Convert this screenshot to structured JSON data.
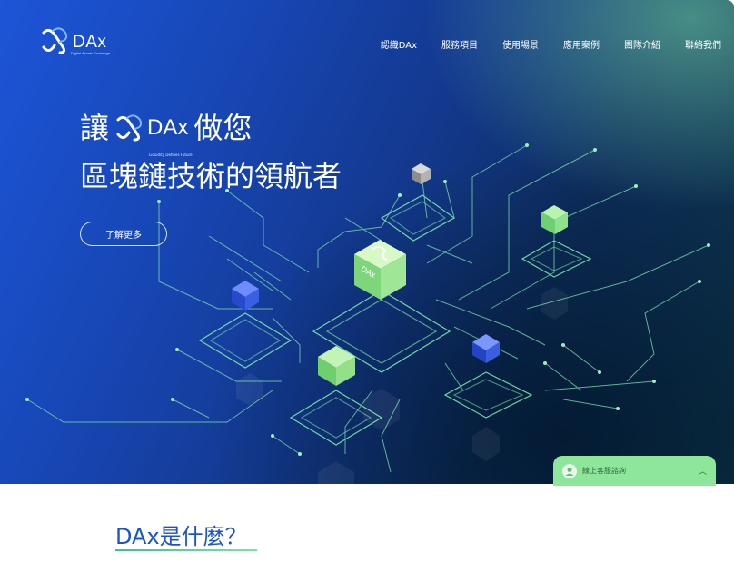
{
  "brand": {
    "name": "DAx",
    "tagline": "Digital Assets Exchange",
    "inline_tagline": "Liquidity Defines Future"
  },
  "nav": {
    "items": [
      {
        "label": "認識DAx"
      },
      {
        "label": "服務項目"
      },
      {
        "label": "使用場景"
      },
      {
        "label": "應用案例"
      },
      {
        "label": "團隊介紹"
      },
      {
        "label": "聯絡我們"
      }
    ]
  },
  "hero": {
    "headline_prefix": "讓",
    "headline_brand": "DAx",
    "headline_suffix": "做您",
    "headline_line2": "區塊鏈技術的領航者",
    "cta_label": "了解更多",
    "chip_label": "DAx"
  },
  "chat_widget": {
    "label": "線上客服諮詢",
    "icon": "support-agent-icon",
    "toggle_icon": "chevron-up-icon"
  },
  "about": {
    "title": "DAx是什麼？"
  },
  "colors": {
    "accent_blue": "#1a54c6",
    "accent_green": "#8ee69a",
    "hero_start": "#1d55d8",
    "hero_end": "#0c3344"
  }
}
